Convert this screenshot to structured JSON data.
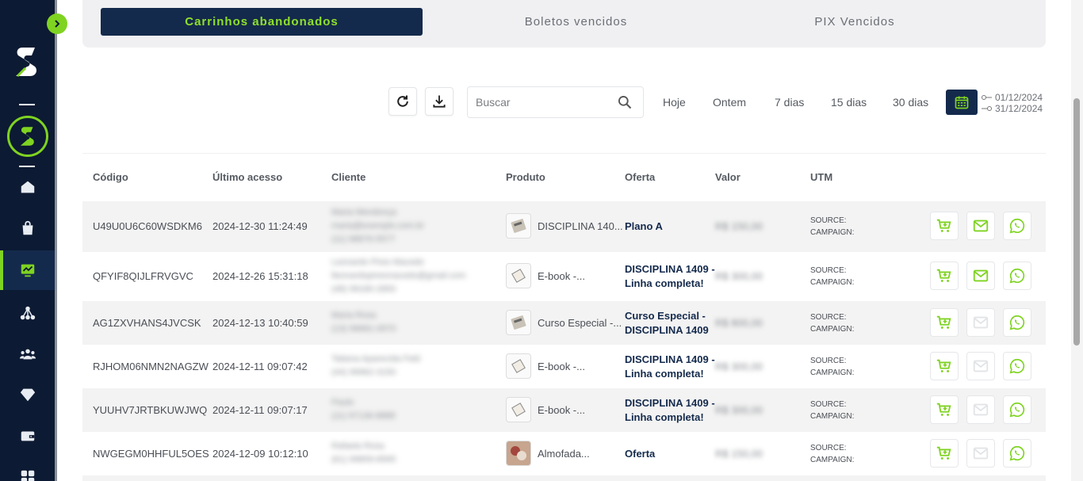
{
  "tabs": [
    {
      "label": "Carrinhos abandonados",
      "active": true
    },
    {
      "label": "Boletos vencidos",
      "active": false
    },
    {
      "label": "PIX Vencidos",
      "active": false
    }
  ],
  "toolbar": {
    "search_placeholder": "Buscar",
    "ranges": [
      "Hoje",
      "Ontem",
      "7 dias",
      "15 dias",
      "30 dias"
    ],
    "date_from": "01/12/2024",
    "date_to": "31/12/2024"
  },
  "table": {
    "headers": [
      "Código",
      "Último acesso",
      "Cliente",
      "Produto",
      "Oferta",
      "Valor",
      "UTM"
    ],
    "utm_source": "SOURCE:",
    "utm_campaign": "CAMPAIGN:",
    "rows": [
      {
        "code": "U49U0U6C60WSDKM6",
        "last_access": "2024-12-30 11:24:49",
        "client": [
          "Maria Mendonça",
          "maria@exemplo.com.br",
          "(11) 98876-5577"
        ],
        "product": "DISCIPLINA 140...",
        "offer": [
          "Plano A"
        ],
        "value": "R$ 150,00",
        "email_enabled": true
      },
      {
        "code": "QFYIF8QIJLFRVGVC",
        "last_access": "2024-12-26 15:31:18",
        "client": [
          "Leonardo Pires Macedo",
          "lleonardopiresmacedo@gmail.com",
          "(48) 99180-2850"
        ],
        "product": "E-book -...",
        "offer": [
          "DISCIPLINA 1409 -",
          "Linha completa!"
        ],
        "value": "R$ 300,00",
        "email_enabled": true
      },
      {
        "code": "AG1ZXVHANS4JVCSK",
        "last_access": "2024-12-13 10:40:59",
        "client": [
          "Maria Rosa",
          "(13) 99681-0970"
        ],
        "product": "Curso Especial -...",
        "offer": [
          "Curso Especial -",
          "DISCIPLINA 1409"
        ],
        "value": "R$ 800,00",
        "email_enabled": false
      },
      {
        "code": "RJHOM06NMN2NAGZW",
        "last_access": "2024-12-11 09:07:42",
        "client": [
          "Tatiana Aparecida Feld",
          "(44) 99962-3150"
        ],
        "product": "E-book -...",
        "offer": [
          "DISCIPLINA 1409 -",
          "Linha completa!"
        ],
        "value": "R$ 300,00",
        "email_enabled": false
      },
      {
        "code": "YUUHV7JRTBKUWJWQ",
        "last_access": "2024-12-11 09:07:17",
        "client": [
          "Paulo",
          "(11) 97136-8888"
        ],
        "product": "E-book -...",
        "offer": [
          "DISCIPLINA 1409 -",
          "Linha completa!"
        ],
        "value": "R$ 300,00",
        "email_enabled": false
      },
      {
        "code": "NWGEGM0HHFUL5OES",
        "last_access": "2024-12-09 10:12:10",
        "client": [
          "Rafaela Rosa",
          "(61) 99859-8565"
        ],
        "product": "Almofada...",
        "offer": [
          "Oferta"
        ],
        "value": "R$ 150,00",
        "email_enabled": false
      }
    ]
  },
  "colors": {
    "navy": "#142a4c",
    "accent_green": "#7fd321",
    "sidebar_bg": "#0c1a33",
    "row_shade": "#f3f3f3"
  }
}
